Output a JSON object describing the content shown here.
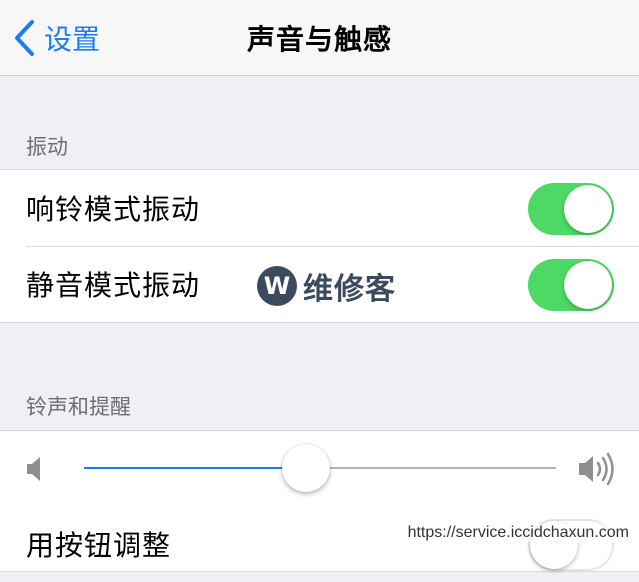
{
  "navbar": {
    "back_label": "设置",
    "title": "声音与触感"
  },
  "vibration_section": {
    "header": "振动",
    "rows": [
      {
        "label": "响铃模式振动",
        "on": true
      },
      {
        "label": "静音模式振动",
        "on": true
      }
    ]
  },
  "ringer_section": {
    "header": "铃声和提醒",
    "volume_level": 0.47,
    "change_with_buttons": {
      "label": "用按钮调整",
      "on": false
    }
  },
  "watermark": {
    "logo_letter": "W",
    "brand": "维修客",
    "url": "https://service.iccidchaxun.com"
  },
  "colors": {
    "accent": "#1a7cf5",
    "toggle_on": "#4cd964",
    "background": "#efeff4"
  },
  "icons": {
    "back": "chevron-left-icon",
    "volume_low": "speaker-low-icon",
    "volume_high": "speaker-high-icon"
  }
}
